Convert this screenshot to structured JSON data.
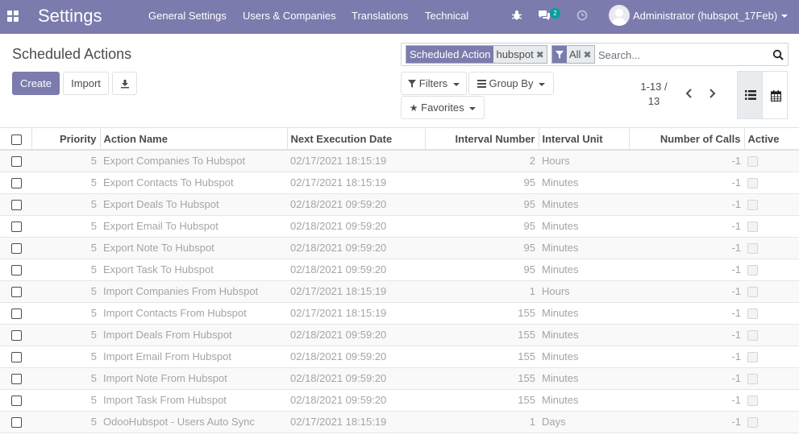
{
  "navbar": {
    "brand": "Settings",
    "menu": [
      "General Settings",
      "Users & Companies",
      "Translations",
      "Technical"
    ],
    "messages_badge": "2",
    "user": "Administrator (hubspot_17Feb)"
  },
  "control_panel": {
    "title": "Scheduled Actions",
    "create_label": "Create",
    "import_label": "Import",
    "facets": [
      {
        "label": "Scheduled Action",
        "value": "hubspot"
      },
      {
        "label": "",
        "value": "All"
      }
    ],
    "search_placeholder": "Search...",
    "filters_label": "Filters",
    "groupby_label": "Group By",
    "favorites_label": "Favorites",
    "pager_range": "1-13 /",
    "pager_total": "13"
  },
  "table": {
    "headers": [
      "Priority",
      "Action Name",
      "Next Execution Date",
      "Interval Number",
      "Interval Unit",
      "Number of Calls",
      "Active"
    ],
    "rows": [
      {
        "priority": "5",
        "name": "Export Companies To Hubspot",
        "next": "02/17/2021 18:15:19",
        "interval": "2",
        "unit": "Hours",
        "calls": "-1"
      },
      {
        "priority": "5",
        "name": "Export Contacts To Hubspot",
        "next": "02/17/2021 18:15:19",
        "interval": "95",
        "unit": "Minutes",
        "calls": "-1"
      },
      {
        "priority": "5",
        "name": "Export Deals To Hubspot",
        "next": "02/18/2021 09:59:20",
        "interval": "95",
        "unit": "Minutes",
        "calls": "-1"
      },
      {
        "priority": "5",
        "name": "Export Email To Hubspot",
        "next": "02/18/2021 09:59:20",
        "interval": "95",
        "unit": "Minutes",
        "calls": "-1"
      },
      {
        "priority": "5",
        "name": "Export Note To Hubspot",
        "next": "02/18/2021 09:59:20",
        "interval": "95",
        "unit": "Minutes",
        "calls": "-1"
      },
      {
        "priority": "5",
        "name": "Export Task To Hubspot",
        "next": "02/18/2021 09:59:20",
        "interval": "95",
        "unit": "Minutes",
        "calls": "-1"
      },
      {
        "priority": "5",
        "name": "Import Companies From Hubspot",
        "next": "02/17/2021 18:15:19",
        "interval": "1",
        "unit": "Hours",
        "calls": "-1"
      },
      {
        "priority": "5",
        "name": "Import Contacts From Hubspot",
        "next": "02/17/2021 18:15:19",
        "interval": "155",
        "unit": "Minutes",
        "calls": "-1"
      },
      {
        "priority": "5",
        "name": "Import Deals From Hubspot",
        "next": "02/18/2021 09:59:20",
        "interval": "155",
        "unit": "Minutes",
        "calls": "-1"
      },
      {
        "priority": "5",
        "name": "Import Email From Hubspot",
        "next": "02/18/2021 09:59:20",
        "interval": "155",
        "unit": "Minutes",
        "calls": "-1"
      },
      {
        "priority": "5",
        "name": "Import Note From Hubspot",
        "next": "02/18/2021 09:59:20",
        "interval": "155",
        "unit": "Minutes",
        "calls": "-1"
      },
      {
        "priority": "5",
        "name": "Import Task From Hubspot",
        "next": "02/18/2021 09:59:20",
        "interval": "155",
        "unit": "Minutes",
        "calls": "-1"
      },
      {
        "priority": "5",
        "name": "OdooHubspot - Users Auto Sync",
        "next": "02/17/2021 18:15:19",
        "interval": "1",
        "unit": "Days",
        "calls": "-1"
      }
    ]
  },
  "colors": {
    "brand": "#7c7bad",
    "accent": "#00a09d",
    "inactive_text": "#a5a5a5"
  }
}
